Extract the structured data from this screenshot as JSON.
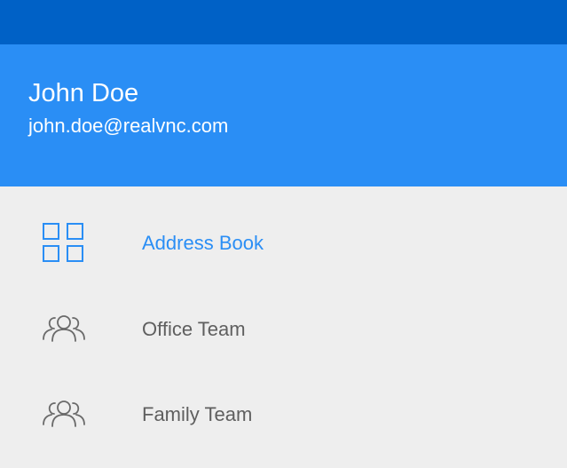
{
  "header": {
    "name": "John Doe",
    "email": "john.doe@realvnc.com"
  },
  "menu": {
    "items": [
      {
        "label": "Address Book",
        "icon": "grid-icon",
        "active": true
      },
      {
        "label": "Office Team",
        "icon": "group-icon",
        "active": false
      },
      {
        "label": "Family Team",
        "icon": "group-icon",
        "active": false
      }
    ]
  },
  "colors": {
    "status_bar": "#0061c6",
    "header": "#2a8ef5",
    "background": "#eeeeee",
    "accent": "#2a8ef5",
    "text_muted": "#5f5f5f"
  }
}
